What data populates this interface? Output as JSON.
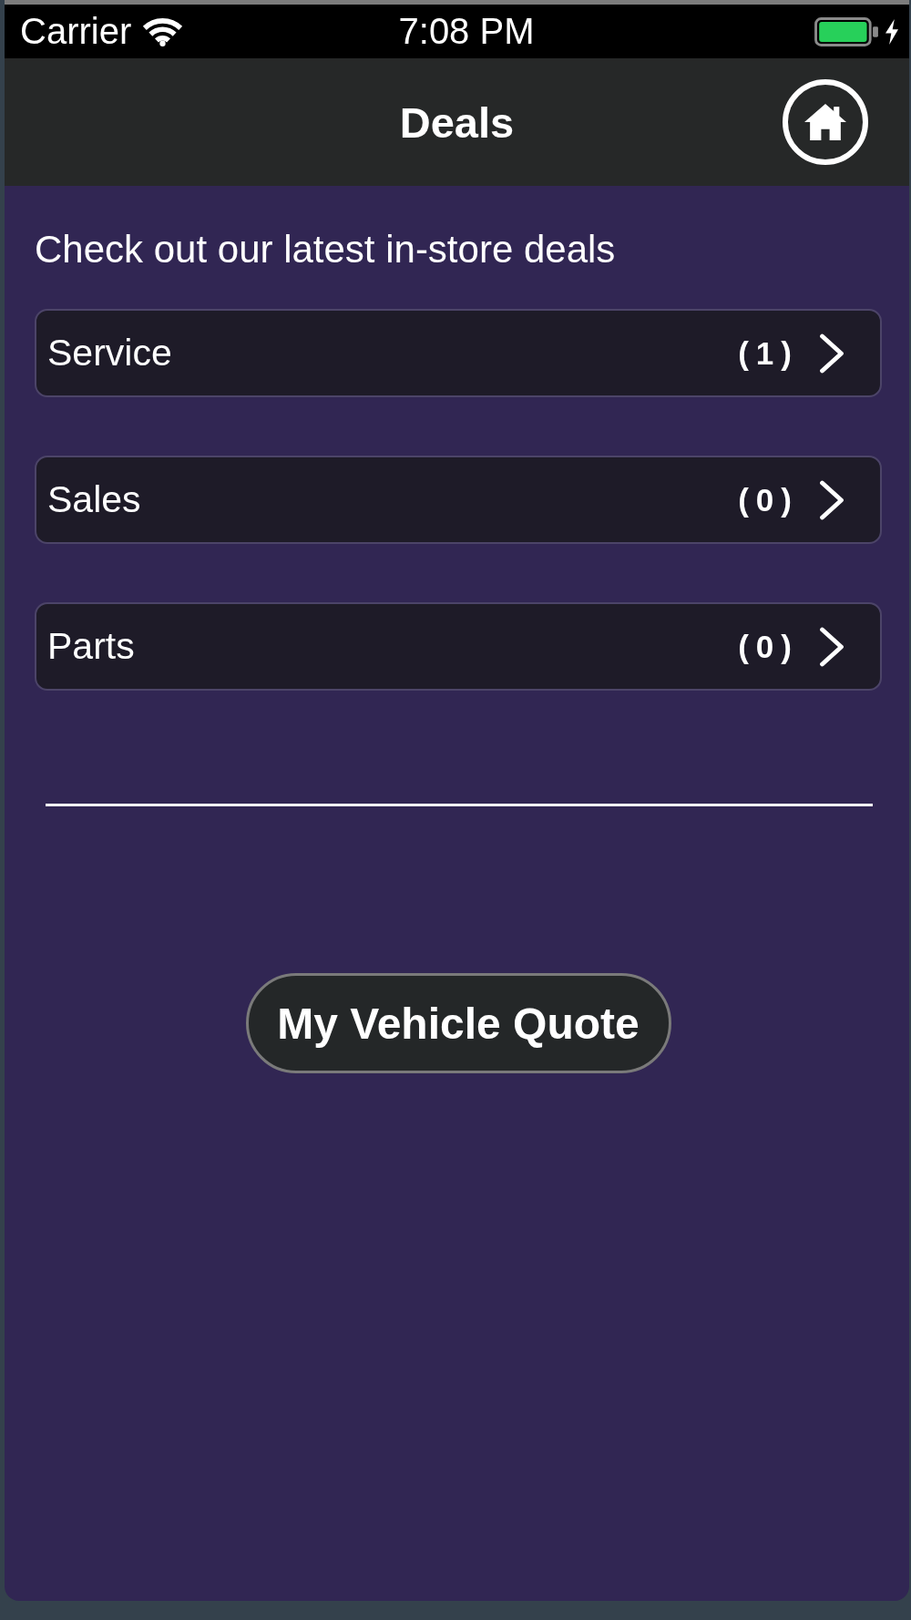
{
  "status_bar": {
    "carrier": "Carrier",
    "time": "7:08 PM"
  },
  "nav_bar": {
    "title": "Deals"
  },
  "intro": "Check out our latest in-store deals",
  "categories": [
    {
      "label": "Service",
      "count": "(1)"
    },
    {
      "label": "Sales",
      "count": "(0)"
    },
    {
      "label": "Parts",
      "count": "(0)"
    }
  ],
  "quote_button": {
    "label": "My Vehicle Quote"
  }
}
